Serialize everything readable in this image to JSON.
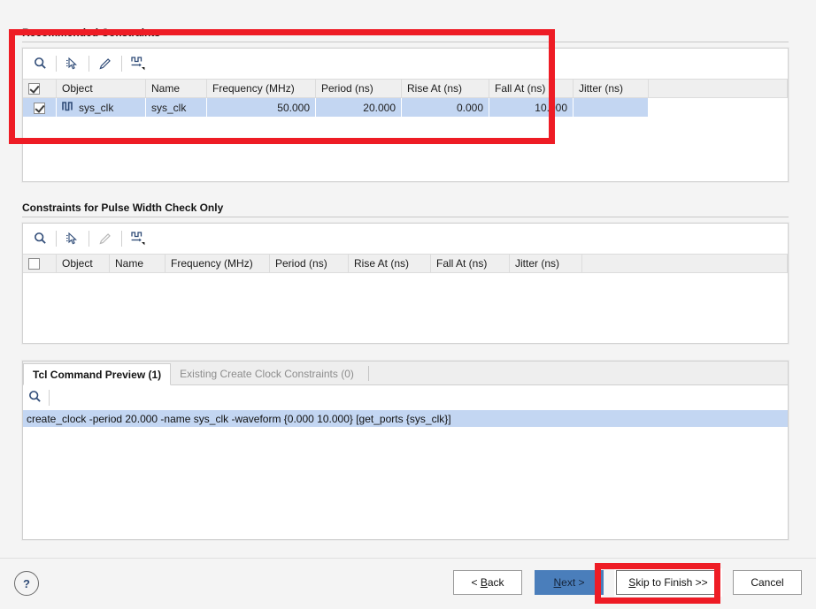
{
  "sections": {
    "recommended": {
      "title": "Recommended Constraints",
      "toolbar": [
        "search-icon",
        "select-icon",
        "edit-icon",
        "clock-arrow-icon"
      ],
      "columns": [
        "Object",
        "Name",
        "Frequency (MHz)",
        "Period (ns)",
        "Rise At (ns)",
        "Fall At (ns)",
        "Jitter (ns)"
      ],
      "header_checkbox_checked": true,
      "rows": [
        {
          "checked": true,
          "object": "sys_clk",
          "object_icon": "clock-waveform-icon",
          "name": "sys_clk",
          "frequency": "50.000",
          "period": "20.000",
          "rise_at": "0.000",
          "fall_at": "10.000",
          "jitter": ""
        }
      ]
    },
    "pulse_width": {
      "title": "Constraints for Pulse Width Check Only",
      "toolbar": [
        "search-icon",
        "select-icon",
        "edit-icon-disabled",
        "clock-arrow-icon"
      ],
      "columns": [
        "Object",
        "Name",
        "Frequency (MHz)",
        "Period (ns)",
        "Rise At (ns)",
        "Fall At (ns)",
        "Jitter (ns)"
      ],
      "header_checkbox_checked": false,
      "rows": []
    },
    "preview": {
      "tabs": [
        {
          "label": "Tcl Command Preview (1)",
          "active": true
        },
        {
          "label": "Existing Create Clock Constraints (0)",
          "active": false
        }
      ],
      "search_icon": "search-icon",
      "lines": [
        "create_clock -period 20.000 -name sys_clk -waveform {0.000 10.000} [get_ports {sys_clk}]"
      ]
    }
  },
  "footer": {
    "help_label": "?",
    "buttons": [
      {
        "name": "back",
        "prefix": "< ",
        "accel": "B",
        "suffix": "ack",
        "style": "normal"
      },
      {
        "name": "next",
        "prefix": "",
        "accel": "N",
        "suffix": "ext >",
        "style": "primary"
      },
      {
        "name": "skip",
        "prefix": "",
        "accel": "S",
        "suffix": "kip to Finish >>",
        "style": "focused"
      },
      {
        "name": "cancel",
        "prefix": "",
        "accel": "",
        "suffix": "Cancel",
        "style": "normal"
      }
    ]
  },
  "annotations": {
    "accent_color": "#ee1c25",
    "boxes": [
      {
        "name": "recommended-constraints-highlight"
      },
      {
        "name": "skip-to-finish-highlight"
      }
    ]
  }
}
